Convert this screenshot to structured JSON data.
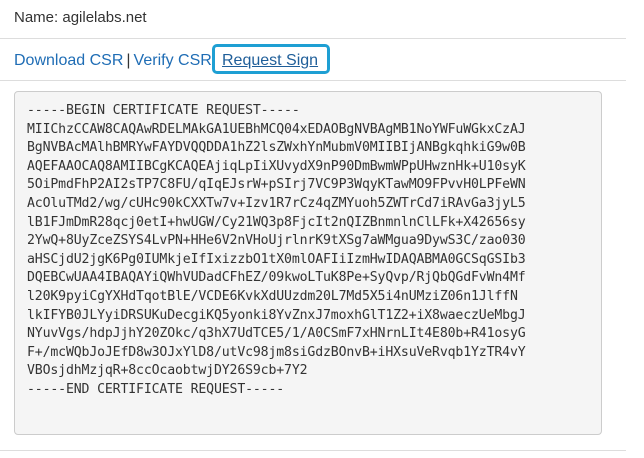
{
  "name_row": {
    "label": "Name:",
    "value": "agilelabs.net"
  },
  "links": {
    "download_csr": "Download CSR",
    "separator": "|",
    "verify_csr": "Verify CSR",
    "request_sign": "Request Sign"
  },
  "csr_lines": [
    "-----BEGIN CERTIFICATE REQUEST-----",
    "MIIChzCCAW8CAQAwRDELMAkGA1UEBhMCQ04xEDAOBgNVBAgMB1NoYWFuWGkxCzAJ",
    "BgNVBAcMAlhBMRYwFAYDVQQDDA1hZ2lsZWxhYnMubmV0MIIBIjANBgkqhkiG9w0B",
    "AQEFAAOCAQ8AMIIBCgKCAQEAjiqLpIiXUvydX9nP90DmBwmWPpUHwznHk+U10syK",
    "5OiPmdFhP2AI2sTP7C8FU/qIqEJsrW+pSIrj7VC9P3WqyKTawMO9FPvvH0LPFeWN",
    "AcOluTMd2/wg/cUHc90kCXXTw7v+Izv1R7rCz4qZMYuoh5ZWTrCd7iRAvGa3jyL5",
    "lB1FJmDmR28qcj0etI+hwUGW/Cy21WQ3p8FjcIt2nQIZBnmnlnClLFk+X42656sy",
    "2YwQ+8UyZceZSYS4LvPN+HHe6V2nVHoUjrlnrK9tXSg7aWMgua9DywS3C/zao030",
    "aHSCjdU2jgK6Pg0IUMkjeIfIxizzbO1tX0mlOAFIiIzmHwIDAQABMA0GCSqGSIb3",
    "DQEBCwUAA4IBAQAYiQWhVUDadCFhEZ/09kwoLTuK8Pe+SyQvp/RjQbQGdFvWn4Mf",
    "l20K9pyiCgYXHdTqotBlE/VCDE6KvkXdUUzdm20L7Md5X5i4nUMziZ06n1JlffN",
    "lkIFYB0JLYyiDRSUKuDecgiKQ5yonki8YvZnxJ7moxhGlT1Z2+iX8waeczUeMbgJ",
    "NYuvVgs/hdpJjhY20ZOkc/q3hX7UdTCE5/1/A0CSmF7xHNrnLIt4E80b+R41osyG",
    "F+/mcWQbJoJEfD8w3OJxYlD8/utVc98jm8siGdzBOnvB+iHXsuVeRvqb1YzTR4vY",
    "VBOsjdhMzjqR+8ccOcaobtwjDY26S9cb+7Y2",
    "-----END CERTIFICATE REQUEST-----"
  ],
  "colors": {
    "link": "#1f6db5",
    "highlight_border": "#1e9fd3",
    "csr_background": "#f5f5f5"
  }
}
